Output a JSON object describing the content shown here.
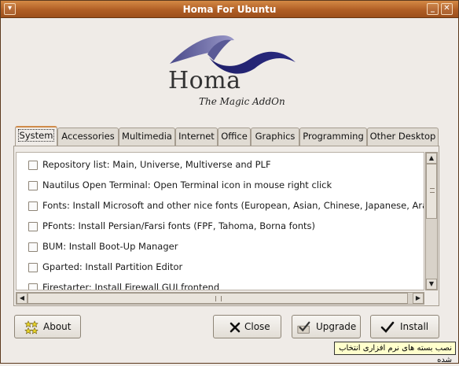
{
  "window": {
    "title": "Homa For Ubuntu"
  },
  "logo": {
    "word": "Homa",
    "tagline": "The Magic AddOn"
  },
  "tabs": [
    {
      "label": "System",
      "active": true
    },
    {
      "label": "Accessories"
    },
    {
      "label": "Multimedia"
    },
    {
      "label": "Internet"
    },
    {
      "label": "Office"
    },
    {
      "label": "Graphics"
    },
    {
      "label": "Programming"
    },
    {
      "label": "Other Desktop"
    }
  ],
  "list": {
    "items": [
      {
        "label": "Repository list: Main, Universe, Multiverse and PLF",
        "checked": false
      },
      {
        "label": "Nautilus Open Terminal: Open Terminal icon in mouse right click",
        "checked": false
      },
      {
        "label": "Fonts: Install Microsoft and other nice fonts (European, Asian, Chinese, Japanese, Arab",
        "checked": false
      },
      {
        "label": "PFonts: Install Persian/Farsi fonts (FPF, Tahoma, Borna fonts)",
        "checked": false
      },
      {
        "label": "BUM: Install Boot-Up Manager",
        "checked": false
      },
      {
        "label": "Gparted: Install Partition Editor",
        "checked": false
      },
      {
        "label": "Firestarter: Install Firewall GUI frontend",
        "checked": false
      }
    ]
  },
  "buttons": {
    "about": "About",
    "close": "Close",
    "upgrade": "Upgrade",
    "install": "Install"
  },
  "tooltip": {
    "text": "نصب بسته های نرم افزاری انتخاب شده"
  },
  "colors": {
    "titlebar": "#b05e25",
    "tab_accent": "#d08b4a",
    "tooltip_bg": "#ffffcc"
  }
}
